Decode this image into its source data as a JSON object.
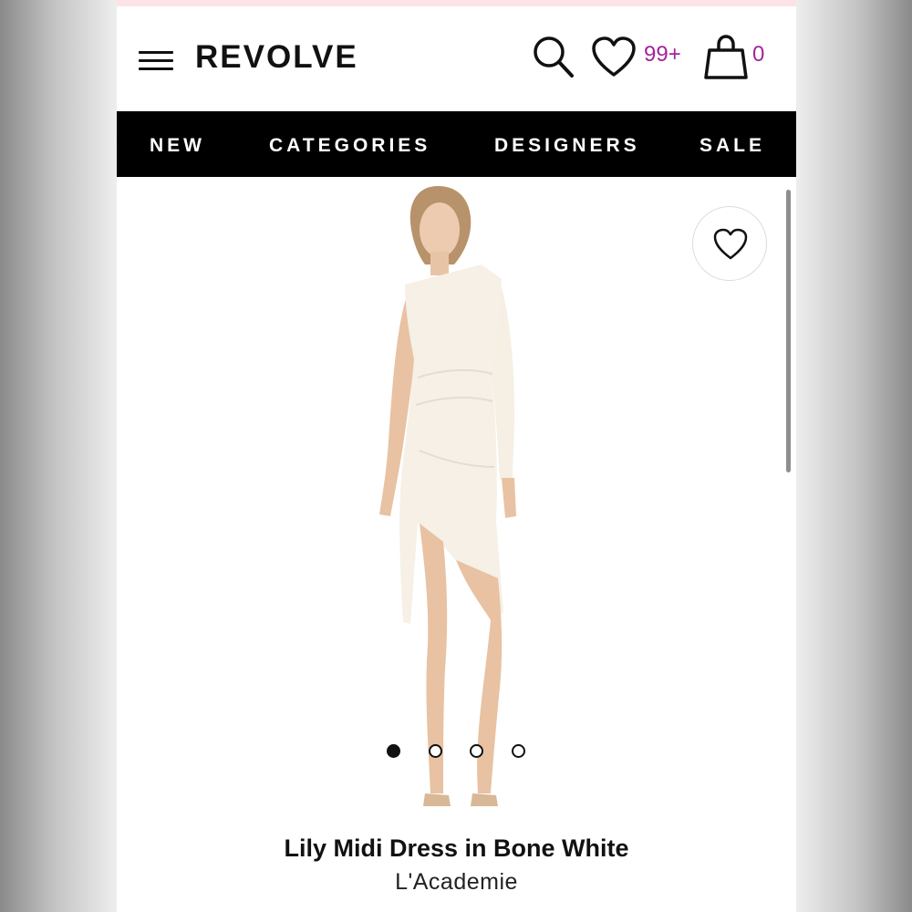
{
  "header": {
    "logo": "REVOLVE",
    "wishlist_count": "99+",
    "bag_count": "0",
    "count_color": "#a4239b"
  },
  "nav": {
    "items": [
      "NEW",
      "CATEGORIES",
      "DESIGNERS",
      "SALE"
    ]
  },
  "product": {
    "name": "Lily Midi Dress in Bone White",
    "brand": "L'Academie",
    "image_count": 4,
    "active_image_index": 0
  },
  "icons": {
    "menu": "hamburger-menu-icon",
    "search": "search-icon",
    "wishlist": "heart-icon",
    "bag": "shopping-bag-icon",
    "favorite": "heart-outline-icon"
  }
}
